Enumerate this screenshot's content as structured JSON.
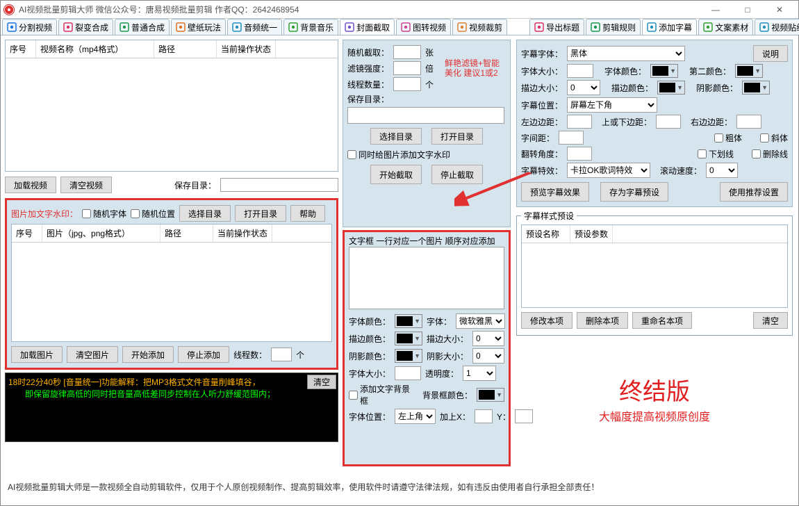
{
  "title": "AI视频批量剪辑大师   微信公众号：唐易视频批量剪辑    作者QQ：2642468954",
  "win": {
    "min": "—",
    "max": "□",
    "close": "✕"
  },
  "tabs_left": [
    {
      "label": "分割视频",
      "color": "#1a73e8"
    },
    {
      "label": "裂变合成",
      "color": "#e03060"
    },
    {
      "label": "普通合成",
      "color": "#1a9850"
    },
    {
      "label": "壁纸玩法",
      "color": "#e07020"
    },
    {
      "label": "音频统一",
      "color": "#2090c0"
    },
    {
      "label": "背景音乐",
      "color": "#30a030"
    },
    {
      "label": "封面截取",
      "color": "#7050d0",
      "active": true
    },
    {
      "label": "图转视频",
      "color": "#d04090"
    },
    {
      "label": "视频裁剪",
      "color": "#e08030"
    }
  ],
  "tabs_right": [
    {
      "label": "导出标题",
      "color": "#e03060"
    },
    {
      "label": "剪辑规则",
      "color": "#1a9850"
    },
    {
      "label": "添加字幕",
      "color": "#2090c0",
      "active": true
    },
    {
      "label": "文案素材",
      "color": "#30a030"
    },
    {
      "label": "视频贴纸",
      "color": "#2090c0"
    }
  ],
  "left": {
    "grid1": {
      "cols": [
        "序号",
        "视频名称（mp4格式）",
        "路径",
        "当前操作状态"
      ]
    },
    "btn_load_video": "加载视频",
    "btn_clear_video": "清空视频",
    "save_dir_lbl": "保存目录：",
    "watermark_title": "图片加文字水印：",
    "chk_rand_font": "随机字体",
    "chk_rand_pos": "随机位置",
    "btn_choose_dir": "选择目录",
    "btn_open_dir": "打开目录",
    "btn_help": "帮助",
    "grid2": {
      "cols": [
        "序号",
        "图片（jpg、png格式）",
        "路径",
        "当前操作状态"
      ]
    },
    "btn_load_img": "加载图片",
    "btn_clear_img": "清空图片",
    "btn_start_add": "开始添加",
    "btn_stop_add": "停止添加",
    "threads_lbl": "线程数：",
    "threads_unit": "个"
  },
  "mid": {
    "rand_cut": "随机截取：",
    "rand_unit": "张",
    "filter": "滤镜强度：",
    "filter_unit": "倍",
    "filter_note1": "鲜艳滤镜+智能",
    "filter_note2": "美化 建议1或2",
    "threads": "线程数量：",
    "threads_unit": "个",
    "save_dir": "保存目录：",
    "btn_choose": "选择目录",
    "btn_open": "打开目录",
    "chk_watermark": "同时给图片添加文字水印",
    "btn_start": "开始截取",
    "btn_stop": "停止截取",
    "textbox_title": "文字框 一行对应一个图片 顺序对应添加",
    "font_color": "字体颜色：",
    "font": "字体：",
    "font_val": "微软雅黑",
    "stroke_color": "描边颜色：",
    "stroke_size": "描边大小：",
    "stroke_val": "0",
    "shadow_color": "阴影颜色：",
    "shadow_size": "阴影大小：",
    "shadow_val": "0",
    "font_size": "字体大小：",
    "opacity": "透明度：",
    "opacity_val": "1",
    "chk_bg": "添加文字背景框",
    "bg_color": "背景框颜色：",
    "pos": "字体位置：",
    "pos_val": "左上角",
    "addx": "加上X：",
    "y": "Y："
  },
  "right": {
    "font_family_lbl": "字幕字体：",
    "font_family": "黑体",
    "btn_explain": "说明",
    "font_size_lbl": "字体大小：",
    "font_color_lbl": "字体颜色：",
    "color2_lbl": "第二颜色：",
    "stroke_size_lbl": "描边大小：",
    "stroke_val": "0",
    "stroke_color_lbl": "描边颜色：",
    "shadow_color_lbl": "阴影颜色：",
    "sub_pos_lbl": "字幕位置：",
    "sub_pos": "屏幕左下角",
    "left_margin": "左边边距：",
    "top_margin": "上或下边距：",
    "right_margin": "右边边距：",
    "letter_sp": "字间距：",
    "chk_bold": "粗体",
    "chk_italic": "斜体",
    "rotate": "翻转角度：",
    "chk_underline": "下划线",
    "chk_strike": "删除线",
    "effect_lbl": "字幕特效：",
    "effect": "卡拉OK歌词特效",
    "scroll_lbl": "滚动速度：",
    "scroll": "0",
    "btn_preview": "预览字幕效果",
    "btn_save_preset": "存为字幕预设",
    "btn_recommend": "使用推荐设置",
    "preset_title": "字幕样式预设",
    "preset_cols": [
      "预设名称",
      "预设参数"
    ],
    "btn_modify": "修改本项",
    "btn_delete": "删除本项",
    "btn_rename": "重命名本项",
    "btn_clear": "清空",
    "brand_big": "终结版",
    "brand_sub": "大幅度提高视频原创度"
  },
  "console": {
    "line1": "18时22分40秒 [音量统一]功能解释：把MP3格式文件音量削峰填谷，",
    "line2": "　　即保留旋律高低的同时把音量高低差同步控制在人听力舒缓范围内；",
    "clear": "清空"
  },
  "footer": "AI视频批量剪辑大师是一款视频全自动剪辑软件，仅用于个人原创视频制作、提高剪辑效率，使用软件时请遵守法律法规，如有违反由使用者自行承担全部责任！"
}
